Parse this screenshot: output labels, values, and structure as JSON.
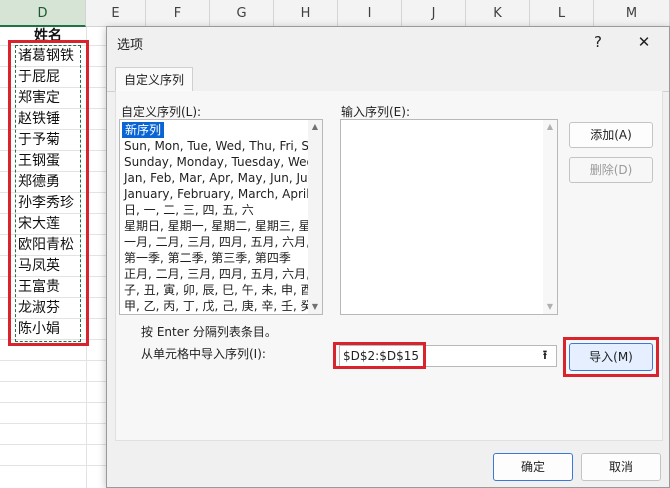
{
  "sheet": {
    "columns": [
      "D",
      "E",
      "F",
      "G",
      "H",
      "I",
      "J",
      "K",
      "L",
      "M"
    ],
    "header": "姓名",
    "names": [
      "诸葛钢铁",
      "于屁屁",
      "郑害定",
      "赵铁锤",
      "于予菊",
      "王钢蛋",
      "郑德勇",
      "孙李秀珍",
      "宋大莲",
      "欧阳青松",
      "马凤英",
      "王富贵",
      "龙淑芬",
      "陈小娟"
    ]
  },
  "dialog": {
    "title": "选项",
    "help": "?",
    "close": "✕",
    "tab": "自定义序列",
    "custom_lists_label": "自定义序列(L):",
    "list_entries_label": "输入序列(E):",
    "custom_lists": [
      "新序列",
      "Sun, Mon, Tue, Wed, Thu, Fri, Sa",
      "Sunday, Monday, Tuesday, Wedn",
      "Jan, Feb, Mar, Apr, May, Jun, Jul,",
      "January, February, March, April, M",
      "日, 一, 二, 三, 四, 五, 六",
      "星期日, 星期一, 星期二, 星期三, 星期",
      "一月, 二月, 三月, 四月, 五月, 六月, 七",
      "第一季, 第二季, 第三季, 第四季",
      "正月, 二月, 三月, 四月, 五月, 六月, 七",
      "子, 丑, 寅, 卯, 辰, 巳, 午, 未, 申, 酉, 戌",
      "甲, 乙, 丙, 丁, 戊, 己, 庚, 辛, 壬, 癸"
    ],
    "add_button": "添加(A)",
    "delete_button": "删除(D)",
    "hint": "按 Enter 分隔列表条目。",
    "import_label": "从单元格中导入序列(I):",
    "import_range": "$D$2:$D$15",
    "import_button": "导入(M)",
    "ok_button": "确定",
    "cancel_button": "取消",
    "collapse_icon": "⭱"
  },
  "colors": {
    "highlight": "#d9232d",
    "excel_green": "#217346",
    "selection": "#0a64d4"
  }
}
